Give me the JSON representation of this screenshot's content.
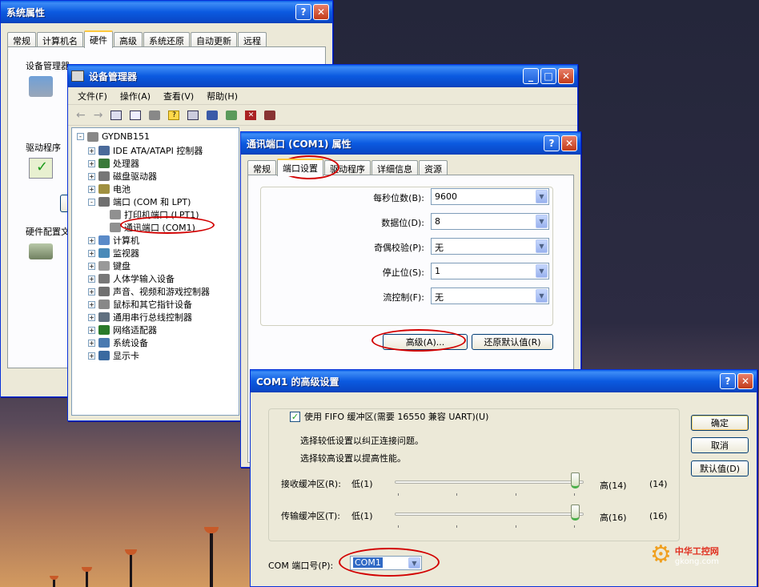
{
  "sysprop": {
    "title": "系统属性",
    "tabs": [
      "常规",
      "计算机名",
      "硬件",
      "高级",
      "系统还原",
      "自动更新",
      "远程"
    ],
    "selected_tab": "硬件",
    "sections": [
      "设备管理器",
      "驱动程序",
      "硬件配置文"
    ]
  },
  "devmgr": {
    "title": "设备管理器",
    "menu": [
      "文件(F)",
      "操作(A)",
      "查看(V)",
      "帮助(H)"
    ],
    "tree": [
      {
        "label": "GYDNB151",
        "level": 0,
        "exp": "-"
      },
      {
        "label": "IDE ATA/ATAPI 控制器",
        "level": 1,
        "exp": "+"
      },
      {
        "label": "处理器",
        "level": 1,
        "exp": "+"
      },
      {
        "label": "磁盘驱动器",
        "level": 1,
        "exp": "+"
      },
      {
        "label": "电池",
        "level": 1,
        "exp": "+"
      },
      {
        "label": "端口 (COM 和 LPT)",
        "level": 1,
        "exp": "-"
      },
      {
        "label": "打印机端口 (LPT1)",
        "level": 2,
        "exp": ""
      },
      {
        "label": "通讯端口 (COM1)",
        "level": 2,
        "exp": ""
      },
      {
        "label": "计算机",
        "level": 1,
        "exp": "+"
      },
      {
        "label": "监视器",
        "level": 1,
        "exp": "+"
      },
      {
        "label": "键盘",
        "level": 1,
        "exp": "+"
      },
      {
        "label": "人体学输入设备",
        "level": 1,
        "exp": "+"
      },
      {
        "label": "声音、视频和游戏控制器",
        "level": 1,
        "exp": "+"
      },
      {
        "label": "鼠标和其它指针设备",
        "level": 1,
        "exp": "+"
      },
      {
        "label": "通用串行总线控制器",
        "level": 1,
        "exp": "+"
      },
      {
        "label": "网络适配器",
        "level": 1,
        "exp": "+"
      },
      {
        "label": "系统设备",
        "level": 1,
        "exp": "+"
      },
      {
        "label": "显示卡",
        "level": 1,
        "exp": "+"
      }
    ]
  },
  "comprop": {
    "title": "通讯端口 (COM1) 属性",
    "tabs": [
      "常规",
      "端口设置",
      "驱动程序",
      "详细信息",
      "资源"
    ],
    "selected_tab": "端口设置",
    "fields": [
      {
        "label": "每秒位数(B):",
        "value": "9600"
      },
      {
        "label": "数据位(D):",
        "value": "8"
      },
      {
        "label": "奇偶校验(P):",
        "value": "无"
      },
      {
        "label": "停止位(S):",
        "value": "1"
      },
      {
        "label": "流控制(F):",
        "value": "无"
      }
    ],
    "advanced_btn": "高级(A)...",
    "restore_btn": "还原默认值(R)"
  },
  "adv": {
    "title": "COM1 的高级设置",
    "fifo_label": "使用 FIFO 缓冲区(需要 16550 兼容 UART)(U)",
    "fifo_checked": true,
    "hint1": "选择较低设置以纠正连接问题。",
    "hint2": "选择较高设置以提高性能。",
    "rx": {
      "label": "接收缓冲区(R):",
      "low": "低(1)",
      "high": "高(14)",
      "value": "(14)",
      "level": 1.0
    },
    "tx": {
      "label": "传输缓冲区(T):",
      "low": "低(1)",
      "high": "高(16)",
      "value": "(16)",
      "level": 1.0
    },
    "com_label": "COM 端口号(P):",
    "com_value": "COM1",
    "ok": "确定",
    "cancel": "取消",
    "defaults": "默认值(D)"
  },
  "watermark": {
    "brand": "中华工控网",
    "url": "gkong.com"
  }
}
